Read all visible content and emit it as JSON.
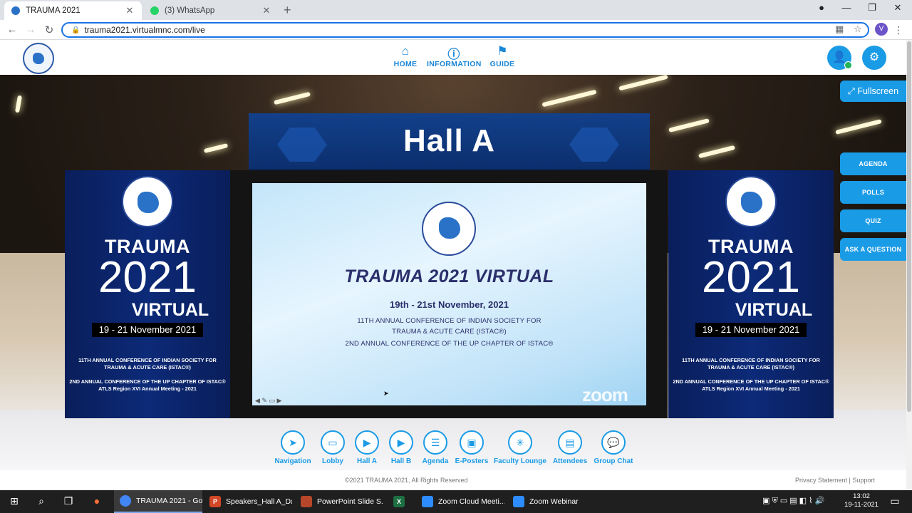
{
  "browser": {
    "tabs": [
      {
        "title": "TRAUMA 2021",
        "active": true,
        "favicon_color": "#2a72c8"
      },
      {
        "title": "(3) WhatsApp",
        "active": false,
        "favicon_color": "#25d366"
      }
    ],
    "url": "trauma2021.virtualmnc.com/live",
    "profile_initial": "V"
  },
  "header": {
    "nav": [
      {
        "label": "HOME",
        "icon": "home-icon"
      },
      {
        "label": "INFORMATION",
        "icon": "info-icon"
      },
      {
        "label": "GUIDE",
        "icon": "signpost-icon"
      }
    ]
  },
  "hall": {
    "title": "Hall A",
    "fullscreen_label": "Fullscreen",
    "side_buttons": [
      "AGENDA",
      "POLLS",
      "QUIZ",
      "ASK A QUESTION"
    ]
  },
  "screen": {
    "title": "TRAUMA 2021 VIRTUAL",
    "date": "19th - 21st November, 2021",
    "line1": "11TH  ANNUAL CONFERENCE OF INDIAN SOCIETY FOR",
    "line2": "TRAUMA & ACUTE CARE (ISTAC®)",
    "line3": "2ND ANNUAL CONFERENCE OF THE UP CHAPTER OF ISTAC®",
    "watermark": "zoom"
  },
  "poster": {
    "t1": "TRAUMA",
    "t2": "2021",
    "t3": "VIRTUAL",
    "date": "19 - 21 November 2021",
    "s1": "11TH  ANNUAL CONFERENCE OF INDIAN SOCIETY FOR",
    "s2": "TRAUMA & ACUTE CARE (ISTAC®)",
    "s3": "2ND ANNUAL CONFERENCE OF THE UP CHAPTER OF ISTAC®",
    "s4": "ATLS Region XVI Annual Meeting - 2021"
  },
  "bottom_nav": [
    {
      "label": "Navigation",
      "icon": "send-icon"
    },
    {
      "label": "Lobby",
      "icon": "desk-icon"
    },
    {
      "label": "Hall A",
      "icon": "play-screen-icon"
    },
    {
      "label": "Hall B",
      "icon": "play-screen-icon"
    },
    {
      "label": "Agenda",
      "icon": "checklist-icon"
    },
    {
      "label": "E-Posters",
      "icon": "poster-icon"
    },
    {
      "label": "Faculty Lounge",
      "icon": "network-icon"
    },
    {
      "label": "Attendees",
      "icon": "badge-icon"
    },
    {
      "label": "Group Chat",
      "icon": "chat-icon"
    }
  ],
  "footer": {
    "copyright": "©2021 TRAUMA 2021, All Rights Reserved",
    "links": "Privacy Statement | Support"
  },
  "taskbar": {
    "apps": [
      {
        "label": "TRAUMA 2021 - Go...",
        "color": "#4285f4",
        "active": true
      },
      {
        "label": "Speakers_Hall A_Da...",
        "color": "#d24726",
        "active": false
      },
      {
        "label": "PowerPoint Slide S...",
        "color": "#b7472a",
        "active": false
      },
      {
        "label": "",
        "color": "#1d6f42",
        "active": false
      },
      {
        "label": "Zoom Cloud Meeti...",
        "color": "#2d8cff",
        "active": false
      },
      {
        "label": "Zoom Webinar",
        "color": "#2d8cff",
        "active": false
      }
    ],
    "time": "13:02",
    "date": "19-11-2021"
  }
}
